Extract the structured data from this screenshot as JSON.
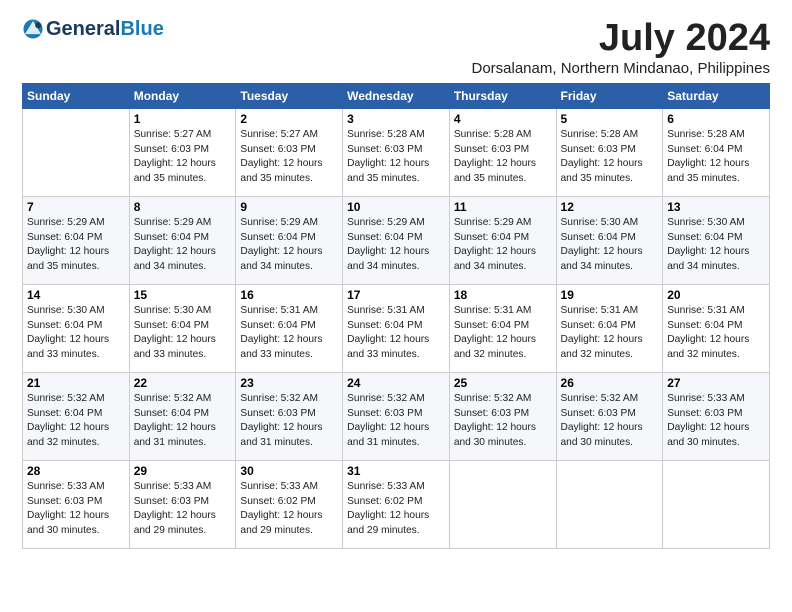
{
  "logo": {
    "general": "General",
    "blue": "Blue"
  },
  "title": {
    "month_year": "July 2024",
    "location": "Dorsalanam, Northern Mindanao, Philippines"
  },
  "days_header": [
    "Sunday",
    "Monday",
    "Tuesday",
    "Wednesday",
    "Thursday",
    "Friday",
    "Saturday"
  ],
  "weeks": [
    [
      {
        "day": "",
        "sunrise": "",
        "sunset": "",
        "daylight": ""
      },
      {
        "day": "1",
        "sunrise": "Sunrise: 5:27 AM",
        "sunset": "Sunset: 6:03 PM",
        "daylight": "Daylight: 12 hours and 35 minutes."
      },
      {
        "day": "2",
        "sunrise": "Sunrise: 5:27 AM",
        "sunset": "Sunset: 6:03 PM",
        "daylight": "Daylight: 12 hours and 35 minutes."
      },
      {
        "day": "3",
        "sunrise": "Sunrise: 5:28 AM",
        "sunset": "Sunset: 6:03 PM",
        "daylight": "Daylight: 12 hours and 35 minutes."
      },
      {
        "day": "4",
        "sunrise": "Sunrise: 5:28 AM",
        "sunset": "Sunset: 6:03 PM",
        "daylight": "Daylight: 12 hours and 35 minutes."
      },
      {
        "day": "5",
        "sunrise": "Sunrise: 5:28 AM",
        "sunset": "Sunset: 6:03 PM",
        "daylight": "Daylight: 12 hours and 35 minutes."
      },
      {
        "day": "6",
        "sunrise": "Sunrise: 5:28 AM",
        "sunset": "Sunset: 6:04 PM",
        "daylight": "Daylight: 12 hours and 35 minutes."
      }
    ],
    [
      {
        "day": "7",
        "sunrise": "Sunrise: 5:29 AM",
        "sunset": "Sunset: 6:04 PM",
        "daylight": "Daylight: 12 hours and 35 minutes."
      },
      {
        "day": "8",
        "sunrise": "Sunrise: 5:29 AM",
        "sunset": "Sunset: 6:04 PM",
        "daylight": "Daylight: 12 hours and 34 minutes."
      },
      {
        "day": "9",
        "sunrise": "Sunrise: 5:29 AM",
        "sunset": "Sunset: 6:04 PM",
        "daylight": "Daylight: 12 hours and 34 minutes."
      },
      {
        "day": "10",
        "sunrise": "Sunrise: 5:29 AM",
        "sunset": "Sunset: 6:04 PM",
        "daylight": "Daylight: 12 hours and 34 minutes."
      },
      {
        "day": "11",
        "sunrise": "Sunrise: 5:29 AM",
        "sunset": "Sunset: 6:04 PM",
        "daylight": "Daylight: 12 hours and 34 minutes."
      },
      {
        "day": "12",
        "sunrise": "Sunrise: 5:30 AM",
        "sunset": "Sunset: 6:04 PM",
        "daylight": "Daylight: 12 hours and 34 minutes."
      },
      {
        "day": "13",
        "sunrise": "Sunrise: 5:30 AM",
        "sunset": "Sunset: 6:04 PM",
        "daylight": "Daylight: 12 hours and 34 minutes."
      }
    ],
    [
      {
        "day": "14",
        "sunrise": "Sunrise: 5:30 AM",
        "sunset": "Sunset: 6:04 PM",
        "daylight": "Daylight: 12 hours and 33 minutes."
      },
      {
        "day": "15",
        "sunrise": "Sunrise: 5:30 AM",
        "sunset": "Sunset: 6:04 PM",
        "daylight": "Daylight: 12 hours and 33 minutes."
      },
      {
        "day": "16",
        "sunrise": "Sunrise: 5:31 AM",
        "sunset": "Sunset: 6:04 PM",
        "daylight": "Daylight: 12 hours and 33 minutes."
      },
      {
        "day": "17",
        "sunrise": "Sunrise: 5:31 AM",
        "sunset": "Sunset: 6:04 PM",
        "daylight": "Daylight: 12 hours and 33 minutes."
      },
      {
        "day": "18",
        "sunrise": "Sunrise: 5:31 AM",
        "sunset": "Sunset: 6:04 PM",
        "daylight": "Daylight: 12 hours and 32 minutes."
      },
      {
        "day": "19",
        "sunrise": "Sunrise: 5:31 AM",
        "sunset": "Sunset: 6:04 PM",
        "daylight": "Daylight: 12 hours and 32 minutes."
      },
      {
        "day": "20",
        "sunrise": "Sunrise: 5:31 AM",
        "sunset": "Sunset: 6:04 PM",
        "daylight": "Daylight: 12 hours and 32 minutes."
      }
    ],
    [
      {
        "day": "21",
        "sunrise": "Sunrise: 5:32 AM",
        "sunset": "Sunset: 6:04 PM",
        "daylight": "Daylight: 12 hours and 32 minutes."
      },
      {
        "day": "22",
        "sunrise": "Sunrise: 5:32 AM",
        "sunset": "Sunset: 6:04 PM",
        "daylight": "Daylight: 12 hours and 31 minutes."
      },
      {
        "day": "23",
        "sunrise": "Sunrise: 5:32 AM",
        "sunset": "Sunset: 6:03 PM",
        "daylight": "Daylight: 12 hours and 31 minutes."
      },
      {
        "day": "24",
        "sunrise": "Sunrise: 5:32 AM",
        "sunset": "Sunset: 6:03 PM",
        "daylight": "Daylight: 12 hours and 31 minutes."
      },
      {
        "day": "25",
        "sunrise": "Sunrise: 5:32 AM",
        "sunset": "Sunset: 6:03 PM",
        "daylight": "Daylight: 12 hours and 30 minutes."
      },
      {
        "day": "26",
        "sunrise": "Sunrise: 5:32 AM",
        "sunset": "Sunset: 6:03 PM",
        "daylight": "Daylight: 12 hours and 30 minutes."
      },
      {
        "day": "27",
        "sunrise": "Sunrise: 5:33 AM",
        "sunset": "Sunset: 6:03 PM",
        "daylight": "Daylight: 12 hours and 30 minutes."
      }
    ],
    [
      {
        "day": "28",
        "sunrise": "Sunrise: 5:33 AM",
        "sunset": "Sunset: 6:03 PM",
        "daylight": "Daylight: 12 hours and 30 minutes."
      },
      {
        "day": "29",
        "sunrise": "Sunrise: 5:33 AM",
        "sunset": "Sunset: 6:03 PM",
        "daylight": "Daylight: 12 hours and 29 minutes."
      },
      {
        "day": "30",
        "sunrise": "Sunrise: 5:33 AM",
        "sunset": "Sunset: 6:02 PM",
        "daylight": "Daylight: 12 hours and 29 minutes."
      },
      {
        "day": "31",
        "sunrise": "Sunrise: 5:33 AM",
        "sunset": "Sunset: 6:02 PM",
        "daylight": "Daylight: 12 hours and 29 minutes."
      },
      {
        "day": "",
        "sunrise": "",
        "sunset": "",
        "daylight": ""
      },
      {
        "day": "",
        "sunrise": "",
        "sunset": "",
        "daylight": ""
      },
      {
        "day": "",
        "sunrise": "",
        "sunset": "",
        "daylight": ""
      }
    ]
  ]
}
